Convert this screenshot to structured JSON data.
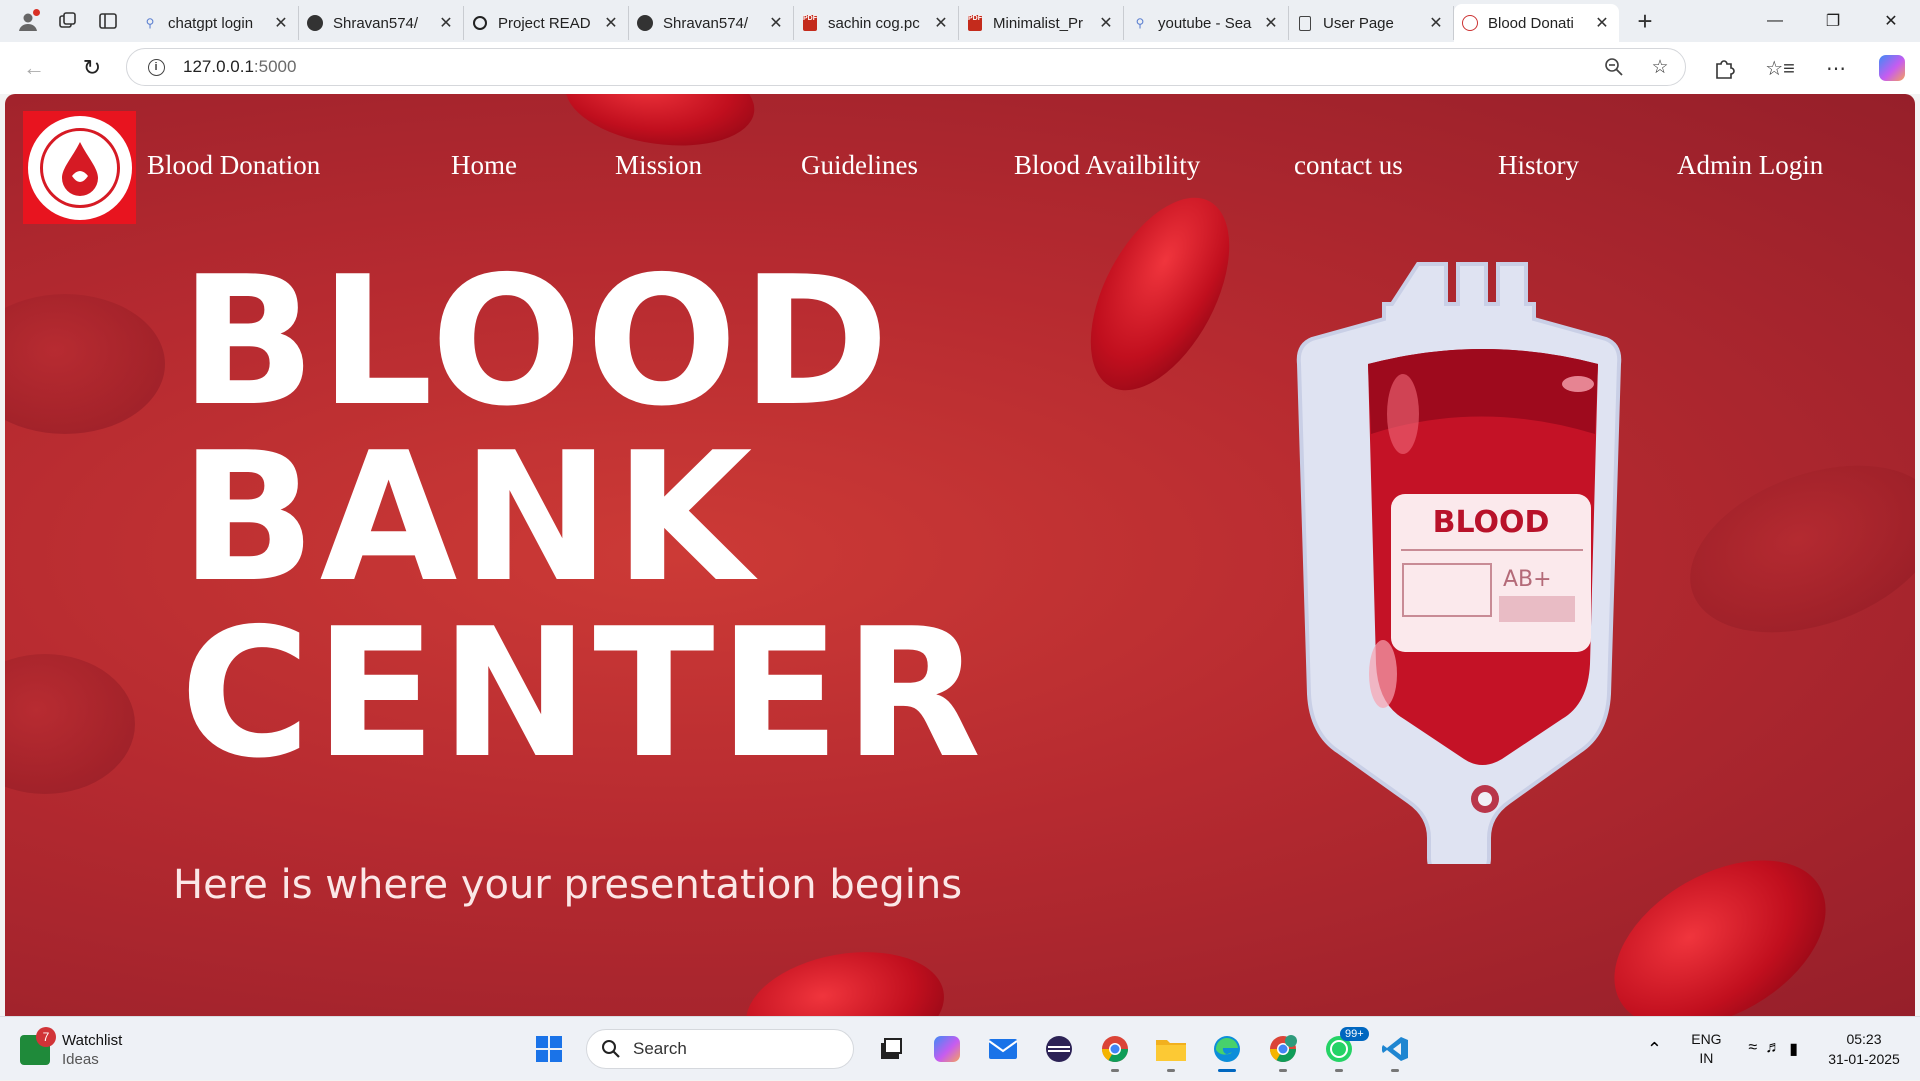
{
  "browser": {
    "tabs": [
      {
        "title": "chatgpt login",
        "favicon": "search-icon",
        "active": false
      },
      {
        "title": "Shravan574/",
        "favicon": "github-icon",
        "active": false
      },
      {
        "title": "Project READ",
        "favicon": "chatgpt-icon",
        "active": false
      },
      {
        "title": "Shravan574/",
        "favicon": "github-icon",
        "active": false
      },
      {
        "title": "sachin cog.pc",
        "favicon": "pdf-icon",
        "active": false
      },
      {
        "title": "Minimalist_Pr",
        "favicon": "pdf-icon",
        "active": false
      },
      {
        "title": "youtube - Sea",
        "favicon": "search-icon",
        "active": false
      },
      {
        "title": "User Page",
        "favicon": "document-icon",
        "active": false
      },
      {
        "title": "Blood Donati",
        "favicon": "site-logo-icon",
        "active": true
      }
    ],
    "pdf_label": "PDF",
    "url_host": "127.0.0.1",
    "url_port": ":5000"
  },
  "site": {
    "brand": "Blood Donation",
    "nav": [
      "Home",
      "Mission",
      "Guidelines",
      "Blood Availbility",
      "contact us",
      "History",
      "Admin Login"
    ]
  },
  "hero": {
    "title_lines": [
      "BLOOD",
      "BANK",
      "CENTER"
    ],
    "subtitle": "Here is where your presentation begins",
    "bag_label": "BLOOD",
    "bag_type": "AB+"
  },
  "taskbar": {
    "widget_title": "Watchlist",
    "widget_sub": "Ideas",
    "widget_badge": "7",
    "search_label": "Search",
    "whatsapp_badge": "99+",
    "lang": "ENG",
    "region": "IN",
    "time": "05:23",
    "date": "31-01-2025"
  },
  "colors": {
    "hero_bg": "#b62a30",
    "logo_red": "#e8141f",
    "nav_text": "#ffffff"
  }
}
